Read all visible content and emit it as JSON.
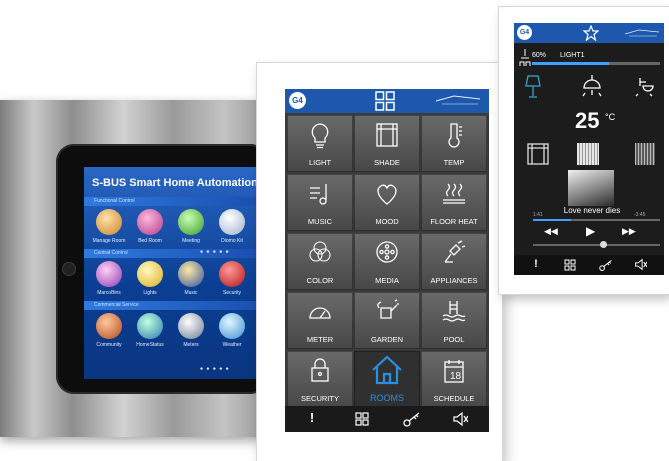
{
  "tablet": {
    "title": "S-BUS Smart Home Automation",
    "sections": [
      "Functional Control",
      "Central Control",
      "Commercial Service"
    ],
    "row1": [
      "Manage Room",
      "Bed Room",
      "Meeting",
      "Diomo Kit"
    ],
    "row2": [
      "MarcoBins",
      "Lights",
      "Music",
      "Security"
    ],
    "row3": [
      "Community",
      "HomeStatus",
      "Meters",
      "Weather"
    ],
    "dots": "● ● ● ● ●"
  },
  "middle_panel": {
    "badge": "G4",
    "tiles": [
      {
        "label": "LIGHT",
        "icon": "bulb-icon"
      },
      {
        "label": "SHADE",
        "icon": "shade-icon"
      },
      {
        "label": "TEMP",
        "icon": "thermometer-icon"
      },
      {
        "label": "MUSIC",
        "icon": "music-icon"
      },
      {
        "label": "MOOD",
        "icon": "heart-icon"
      },
      {
        "label": "FLOOR HEAT",
        "icon": "floor-heat-icon"
      },
      {
        "label": "COLOR",
        "icon": "color-icon"
      },
      {
        "label": "MEDIA",
        "icon": "media-icon"
      },
      {
        "label": "APPLIANCES",
        "icon": "plug-icon"
      },
      {
        "label": "METER",
        "icon": "meter-icon"
      },
      {
        "label": "GARDEN",
        "icon": "watering-can-icon"
      },
      {
        "label": "POOL",
        "icon": "pool-icon"
      },
      {
        "label": "SECURITY",
        "icon": "lock-icon"
      },
      {
        "label": "ROOMS",
        "icon": "house-icon"
      },
      {
        "label": "SCHEDULE",
        "icon": "calendar-icon"
      }
    ],
    "footer": [
      "!",
      "grid-icon",
      "key-icon",
      "mute-icon"
    ]
  },
  "right_panel": {
    "badge": "G4",
    "dimmer_percent": "60%",
    "dimmer_value": 0.6,
    "dimmer_name": "LIGHT1",
    "temperature": "25",
    "temperature_unit": "°C",
    "song": "Love never dies",
    "time_elapsed": "1:41",
    "time_remaining": "-3:45",
    "progress": 0.3,
    "volume": 0.55
  },
  "colors": {
    "header_blue": "#1d58ad",
    "accent_blue": "#2a8fe0",
    "tablet_blue": "#0b3f93"
  }
}
